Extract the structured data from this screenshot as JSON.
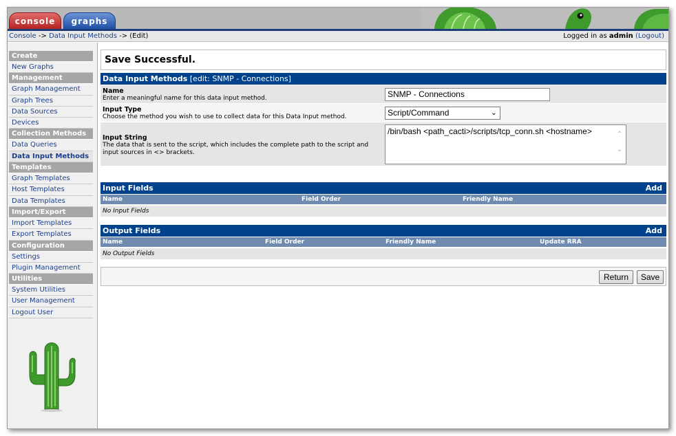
{
  "tabs": {
    "console": "console",
    "graphs": "graphs"
  },
  "breadcrumb": {
    "console": "Console",
    "sep1": " -> ",
    "data_input_methods": "Data Input Methods",
    "sep2": " -> ",
    "current": "(Edit)"
  },
  "login": {
    "prefix": "Logged in as ",
    "user": "admin",
    "logout": "(Logout)"
  },
  "menu": {
    "create": {
      "title": "Create",
      "items": [
        "New Graphs"
      ]
    },
    "management": {
      "title": "Management",
      "items": [
        "Graph Management",
        "Graph Trees",
        "Data Sources",
        "Devices"
      ]
    },
    "collection": {
      "title": "Collection Methods",
      "items": [
        "Data Queries",
        "Data Input Methods"
      ]
    },
    "templates": {
      "title": "Templates",
      "items": [
        "Graph Templates",
        "Host Templates",
        "Data Templates"
      ]
    },
    "importexport": {
      "title": "Import/Export",
      "items": [
        "Import Templates",
        "Export Templates"
      ]
    },
    "configuration": {
      "title": "Configuration",
      "items": [
        "Settings",
        "Plugin Management"
      ]
    },
    "utilities": {
      "title": "Utilities",
      "items": [
        "System Utilities",
        "User Management",
        "Logout User"
      ]
    }
  },
  "message": "Save Successful.",
  "form": {
    "header_title": "Data Input Methods",
    "header_sub": " [edit: SNMP - Connections]",
    "name": {
      "title": "Name",
      "desc": "Enter a meaningful name for this data input method.",
      "value": "SNMP - Connections"
    },
    "input_type": {
      "title": "Input Type",
      "desc": "Choose the method you wish to use to collect data for this Data Input method.",
      "value": "Script/Command"
    },
    "input_string": {
      "title": "Input String",
      "desc": "The data that is sent to the script, which includes the complete path to the script and input sources in <> brackets.",
      "value": "/bin/bash <path_cacti>/scripts/tcp_conn.sh <hostname>"
    }
  },
  "input_fields": {
    "title": "Input Fields",
    "add": "Add",
    "columns": [
      "Name",
      "Field Order",
      "Friendly Name"
    ],
    "empty": "No Input Fields"
  },
  "output_fields": {
    "title": "Output Fields",
    "add": "Add",
    "columns": [
      "Name",
      "Field Order",
      "Friendly Name",
      "Update RRA"
    ],
    "empty": "No Output Fields"
  },
  "buttons": {
    "return": "Return",
    "save": "Save"
  },
  "colors": {
    "header_blue": "#00438c",
    "column_header": "#6f8bb0",
    "link": "#1b3f8b",
    "menu_heading": "#a6a6a6"
  }
}
